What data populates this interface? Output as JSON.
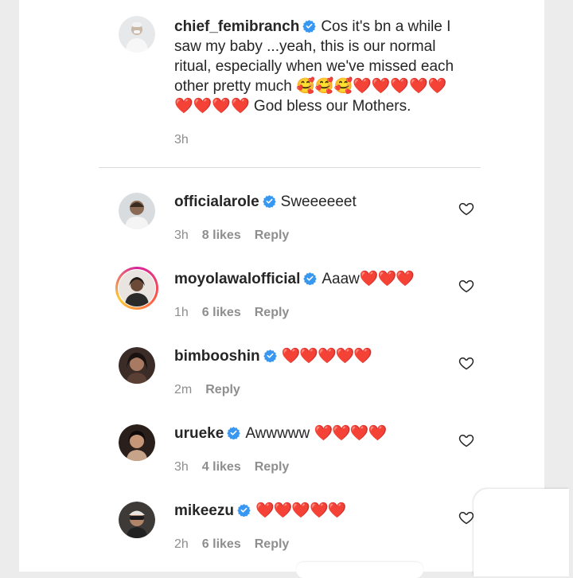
{
  "post": {
    "username": "chief_femibranch",
    "caption_line1": "Cos it's bn a while I",
    "caption_line2": "saw my baby ...yeah, this is our normal",
    "caption_line3": "ritual, especially when we've missed each",
    "caption_line4_text": "other pretty much ",
    "caption_emojis": "🥰🥰🥰❤️❤️❤️❤️❤️",
    "caption_line5_hearts": "❤️❤️❤️❤️",
    "caption_line5_text": " God bless our Mothers.",
    "time": "3h"
  },
  "comments": [
    {
      "username": "officialarole",
      "text": "Sweeeeeet",
      "time": "3h",
      "likes": "8 likes",
      "reply": "Reply"
    },
    {
      "username": "moyolawalofficial",
      "text": "Aaaw",
      "hearts": "❤️❤️❤️",
      "time": "1h",
      "likes": "6 likes",
      "reply": "Reply"
    },
    {
      "username": "bimbooshin",
      "text": "",
      "hearts": "❤️❤️❤️❤️❤️",
      "time": "2m",
      "likes": "",
      "reply": "Reply"
    },
    {
      "username": "urueke",
      "text": "Awwwww ",
      "hearts": "❤️❤️❤️❤️",
      "time": "3h",
      "likes": "4 likes",
      "reply": "Reply"
    },
    {
      "username": "mikeezu",
      "text": "",
      "hearts": "❤️❤️❤️❤️❤️",
      "time": "2h",
      "likes": "6 likes",
      "reply": "Reply"
    }
  ],
  "colors": {
    "verified": "#3897f0",
    "heart": "#e0242b",
    "text": "#262626",
    "muted": "#8e8e8e"
  },
  "icons": {
    "verified": "verified-badge-icon",
    "like": "heart-outline-icon"
  }
}
